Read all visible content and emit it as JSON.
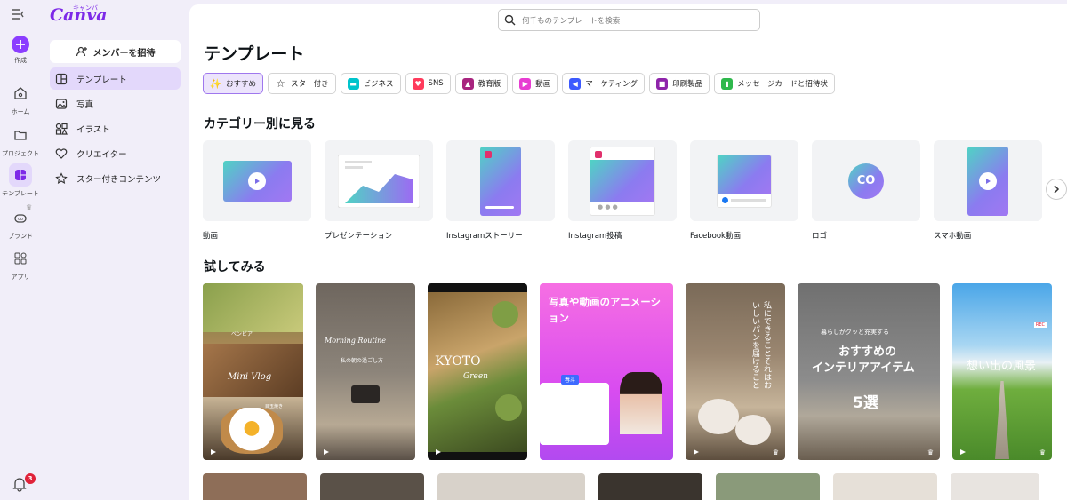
{
  "brand": {
    "logo": "Canva",
    "logo_kana": "キャンバ",
    "accent": "#8b3dff"
  },
  "rail": {
    "create": "作成",
    "home": "ホーム",
    "projects": "プロジェクト",
    "templates": "テンプレート",
    "brand": "ブランド",
    "apps": "アプリ",
    "notifications_count": "3"
  },
  "sidebar": {
    "invite": "メンバーを招待",
    "items": [
      {
        "label": "テンプレート",
        "icon": "template-icon"
      },
      {
        "label": "写真",
        "icon": "photo-icon"
      },
      {
        "label": "イラスト",
        "icon": "shapes-icon"
      },
      {
        "label": "クリエイター",
        "icon": "heart-icon"
      },
      {
        "label": "スター付きコンテンツ",
        "icon": "star-icon"
      }
    ]
  },
  "search": {
    "placeholder": "何千ものテンプレートを検索"
  },
  "main": {
    "title": "テンプレート",
    "chips": [
      {
        "label": "おすすめ",
        "icon": "sparkle-icon",
        "color": "#7d2ae8"
      },
      {
        "label": "スター付き",
        "icon": "star-icon",
        "color": "#333333"
      },
      {
        "label": "ビジネス",
        "icon": "briefcase-icon",
        "color": "#00c4cc"
      },
      {
        "label": "SNS",
        "icon": "heart-icon",
        "color": "#ff3b5c"
      },
      {
        "label": "教育版",
        "icon": "graduation-cap-icon",
        "color": "#a8247f"
      },
      {
        "label": "動画",
        "icon": "video-icon",
        "color": "#e83dd2"
      },
      {
        "label": "マーケティング",
        "icon": "megaphone-icon",
        "color": "#3d5afe"
      },
      {
        "label": "印刷製品",
        "icon": "printer-icon",
        "color": "#8e24aa"
      },
      {
        "label": "メッセージカードと招待状",
        "icon": "card-icon",
        "color": "#2eb84c"
      }
    ],
    "categories_title": "カテゴリー別に見る",
    "categories": [
      {
        "label": "動画"
      },
      {
        "label": "プレゼンテーション"
      },
      {
        "label": "Instagramストーリー"
      },
      {
        "label": "Instagram投稿"
      },
      {
        "label": "Facebook動画"
      },
      {
        "label": "ロゴ",
        "logo_text": "CO"
      },
      {
        "label": "スマホ動画"
      }
    ],
    "try_title": "試してみる",
    "try_cards": [
      {
        "texts": [
          "ベンビア",
          "Mini Vlog",
          "目玉焼き"
        ]
      },
      {
        "texts": [
          "Morning Routine",
          "私の朝の過ごし方"
        ]
      },
      {
        "texts": [
          "KYOTO",
          "Green"
        ]
      },
      {
        "texts": [
          "写真や動画のアニメーション",
          "春斗"
        ]
      },
      {
        "texts": [
          "私にできることそれはおいしいパンを届けること"
        ]
      },
      {
        "texts": [
          "暮らしがグッと充実する",
          "おすすめの",
          "インテリアアイテム",
          "5選"
        ]
      },
      {
        "texts": [
          "想い出の風景",
          "REC"
        ]
      }
    ]
  }
}
